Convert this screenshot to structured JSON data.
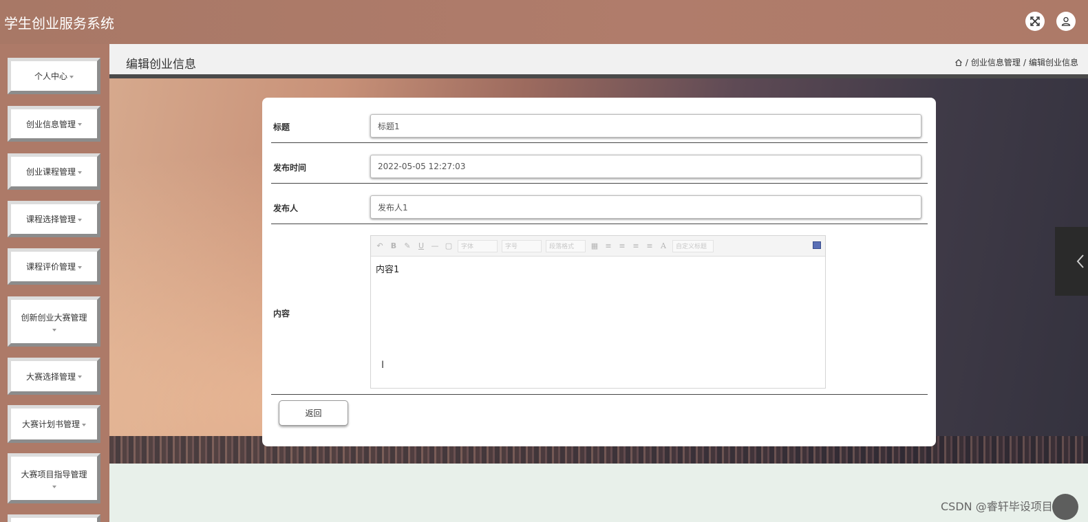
{
  "header": {
    "app_title": "学生创业服务系统",
    "fullscreen_icon": "expand-icon",
    "user_icon": "user-icon"
  },
  "sidebar": {
    "items": [
      {
        "label": "个人中心"
      },
      {
        "label": "创业信息管理"
      },
      {
        "label": "创业课程管理"
      },
      {
        "label": "课程选择管理"
      },
      {
        "label": "课程评价管理"
      },
      {
        "label": "创新创业大赛管理"
      },
      {
        "label": "大赛选择管理"
      },
      {
        "label": "大赛计划书管理"
      },
      {
        "label": "大赛项目指导管理"
      }
    ]
  },
  "page": {
    "title": "编辑创业信息",
    "breadcrumb": {
      "sep1": "/",
      "item1": "创业信息管理",
      "sep2": "/",
      "item2": "编辑创业信息"
    }
  },
  "form": {
    "title_label": "标题",
    "title_value": "标题1",
    "time_label": "发布时间",
    "time_value": "2022-05-05 12:27:03",
    "publisher_label": "发布人",
    "publisher_value": "发布人1",
    "content_label": "内容",
    "content_value": "内容1",
    "editor_toolbar": {
      "font_select": "字体",
      "size_select": "字号",
      "paragraph_select": "段落格式",
      "custom_title_select": "自定义标题"
    },
    "back_button": "返回"
  },
  "watermark": "CSDN @睿轩毕设项目"
}
